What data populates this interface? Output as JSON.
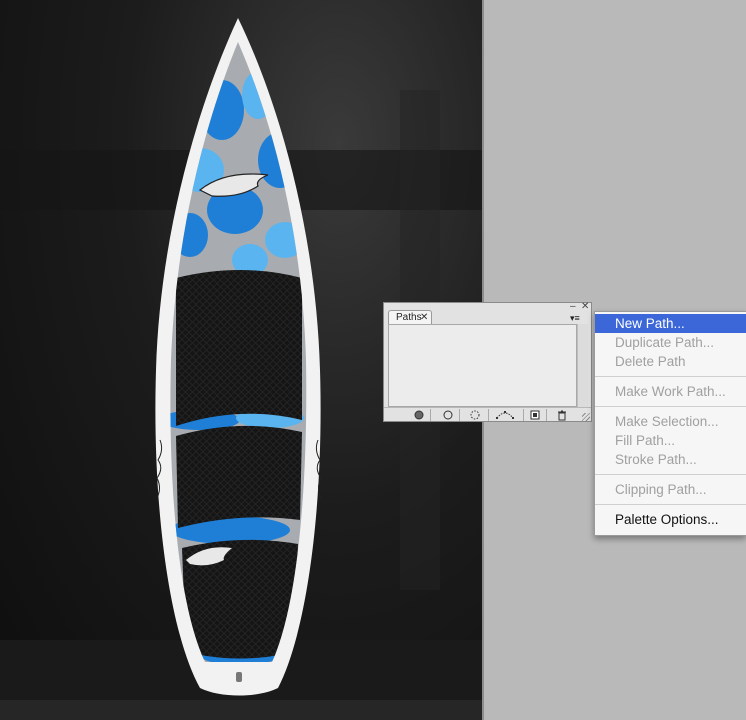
{
  "palette": {
    "tab_label": "Paths",
    "tab_close": "✕",
    "minimize_glyph": "–",
    "close_glyph": "✕",
    "menu_glyph": "▾≡",
    "footer_icons": [
      "fill-path-icon",
      "stroke-path-icon",
      "load-selection-icon",
      "make-work-path-icon",
      "new-path-icon",
      "delete-path-icon"
    ]
  },
  "context_menu": {
    "groups": [
      [
        {
          "label": "New Path...",
          "enabled": true,
          "selected": true
        },
        {
          "label": "Duplicate Path...",
          "enabled": false
        },
        {
          "label": "Delete Path",
          "enabled": false
        }
      ],
      [
        {
          "label": "Make Work Path...",
          "enabled": false
        }
      ],
      [
        {
          "label": "Make Selection...",
          "enabled": false
        },
        {
          "label": "Fill Path...",
          "enabled": false
        },
        {
          "label": "Stroke Path...",
          "enabled": false
        }
      ],
      [
        {
          "label": "Clipping Path...",
          "enabled": false
        }
      ],
      [
        {
          "label": "Palette Options...",
          "enabled": true
        }
      ]
    ]
  },
  "colors": {
    "menu_highlight": "#3b67d8",
    "board_blue": "#1f7fd6",
    "board_light_blue": "#5ab4f0",
    "board_gray": "#a9a9a9",
    "pad_black": "#161616"
  }
}
